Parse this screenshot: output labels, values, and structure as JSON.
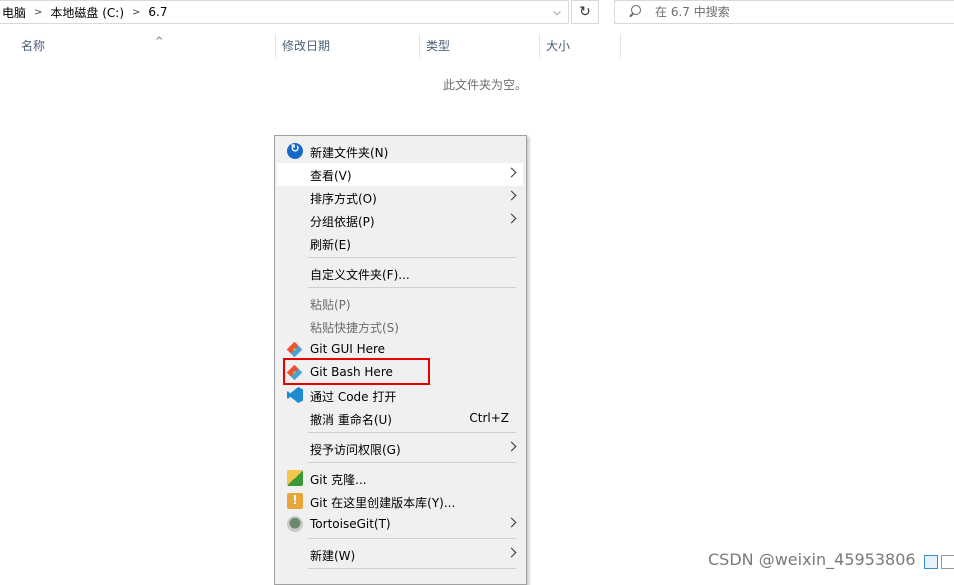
{
  "address_bar": {
    "crumbs": [
      "电脑",
      "本地磁盘 (C:)",
      "6.7"
    ],
    "separator": ">"
  },
  "search": {
    "placeholder": "在 6.7 中搜索"
  },
  "columns": [
    "名称",
    "修改日期",
    "类型",
    "大小"
  ],
  "empty_message": "此文件夹为空。",
  "context_menu": {
    "items": [
      {
        "label": "新建文件夹(N)",
        "icon": "new-folder-icon"
      },
      {
        "label": "查看(V)",
        "submenu": true
      },
      {
        "label": "排序方式(O)",
        "submenu": true
      },
      {
        "label": "分组依据(P)",
        "submenu": true
      },
      {
        "label": "刷新(E)"
      },
      {
        "label": "自定义文件夹(F)..."
      },
      {
        "label": "粘贴(P)",
        "disabled": true
      },
      {
        "label": "粘贴快捷方式(S)",
        "disabled": true
      },
      {
        "label": "Git GUI Here",
        "icon": "git-icon"
      },
      {
        "label": "Git Bash Here",
        "icon": "git-icon",
        "highlighted": true
      },
      {
        "label": "通过 Code 打开",
        "icon": "vscode-icon"
      },
      {
        "label": "撤消 重命名(U)",
        "shortcut": "Ctrl+Z"
      },
      {
        "label": "授予访问权限(G)",
        "submenu": true
      },
      {
        "label": "Git 克隆...",
        "icon": "git-clone-icon"
      },
      {
        "label": "Git 在这里创建版本库(Y)...",
        "icon": "git-repo-icon"
      },
      {
        "label": "TortoiseGit(T)",
        "icon": "tortoisegit-icon",
        "submenu": true
      },
      {
        "label": "新建(W)",
        "submenu": true
      }
    ]
  },
  "watermark": "CSDN @weixin_45953806",
  "colors": {
    "highlight_box": "#e60000",
    "menu_background": "#f0f0f0",
    "header_text": "#4c607a"
  }
}
